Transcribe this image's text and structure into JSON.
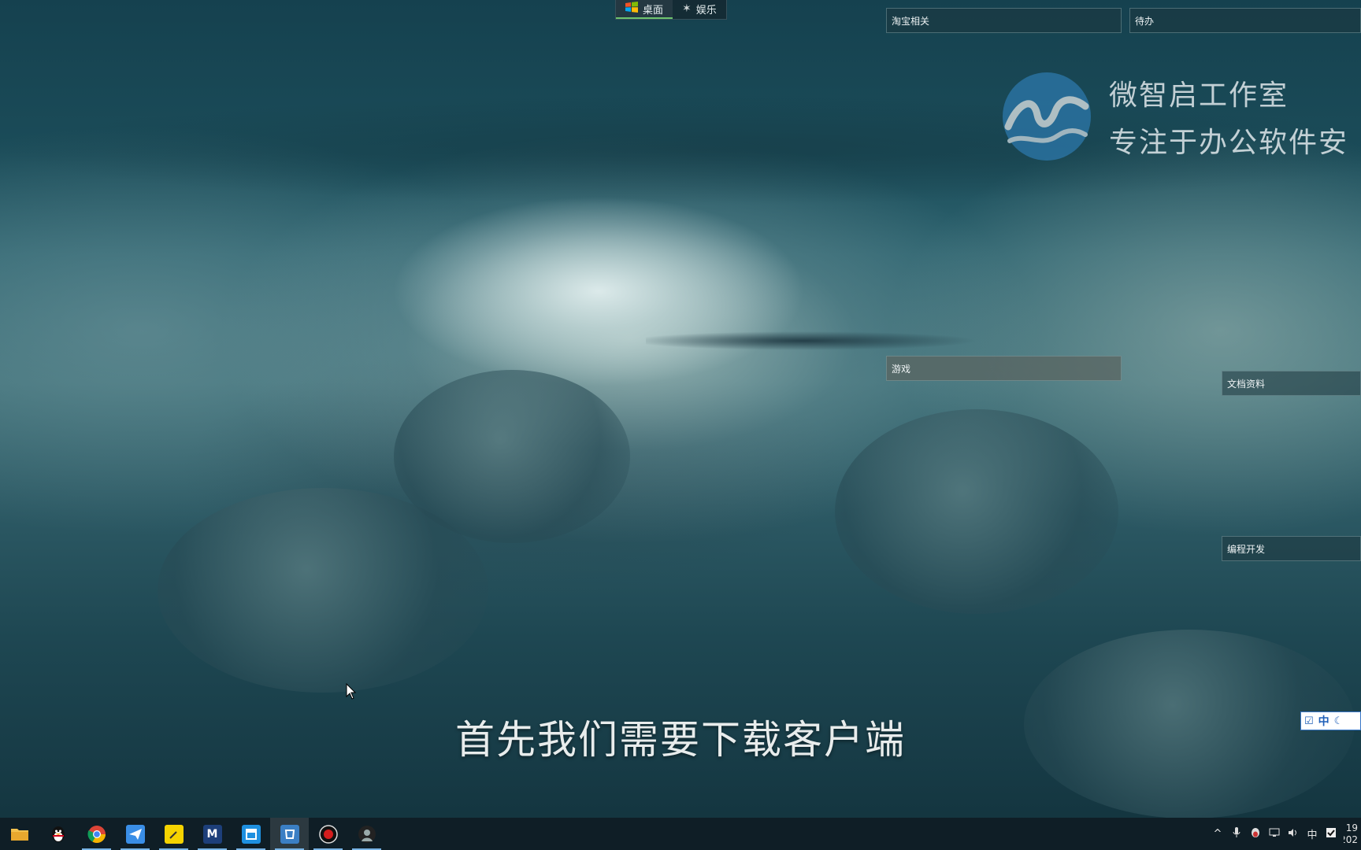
{
  "top_tabs": [
    {
      "label": "桌面",
      "icon": "windows-flag-icon",
      "active": true
    },
    {
      "label": "娱乐",
      "icon": "star-icon",
      "active": false
    }
  ],
  "fences": {
    "taobao": "淘宝相关",
    "todo": "待办",
    "games": "游戏",
    "docs": "文档资料",
    "dev": "编程开发"
  },
  "watermark": {
    "title": "微智启工作室",
    "subtitle": "专注于办公软件安",
    "logo": "wave-logo"
  },
  "subtitle": "首先我们需要下载客户端",
  "ime": {
    "lang": "中",
    "icons": [
      "ime-check-icon",
      "ime-chinese-icon",
      "ime-moon-icon"
    ]
  },
  "taskbar": {
    "apps": [
      {
        "name": "file-explorer",
        "icon": "folder-icon",
        "color": "#f2c14e"
      },
      {
        "name": "qq",
        "icon": "penguin-icon",
        "color": "#111111"
      },
      {
        "name": "chrome",
        "icon": "chrome-icon",
        "color": "#dd4b39"
      },
      {
        "name": "feishu",
        "icon": "bird-icon",
        "color": "#3a8ee6"
      },
      {
        "name": "sticky-notes",
        "icon": "note-icon",
        "color": "#f5d300"
      },
      {
        "name": "app-m",
        "icon": "m-icon",
        "color": "#2a6fd6"
      },
      {
        "name": "app-blue",
        "icon": "window-icon",
        "color": "#1e90e0"
      },
      {
        "name": "app-cup",
        "icon": "cup-icon",
        "color": "#3b7fc4"
      },
      {
        "name": "screen-recorder",
        "icon": "record-icon",
        "color": "#d51d1d"
      },
      {
        "name": "app-avatar",
        "icon": "avatar-icon",
        "color": "#222222"
      }
    ],
    "tray": {
      "chevron": "^",
      "lang": "中",
      "clock_time": "19",
      "clock_date": "202"
    }
  }
}
